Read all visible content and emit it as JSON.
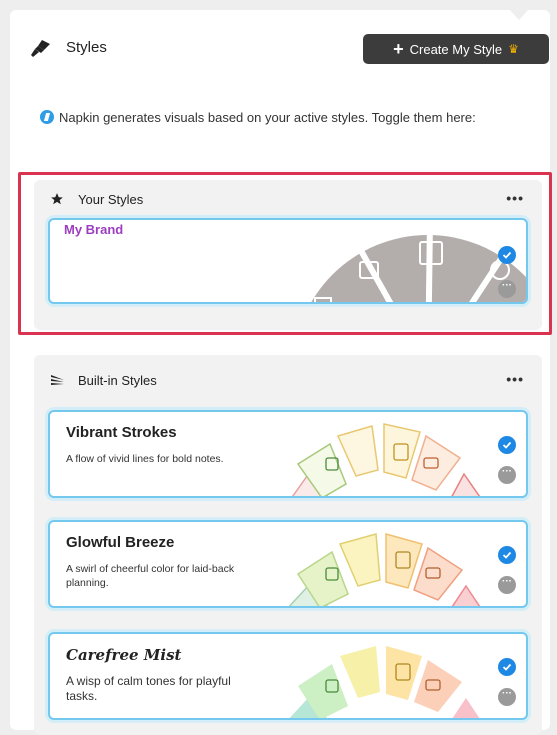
{
  "header": {
    "title": "Styles",
    "create_button_label": "Create My Style",
    "create_button_icon": "plus-icon",
    "premium_icon": "crown-icon"
  },
  "info": {
    "text": "Napkin generates visuals based on your active styles. Toggle them here:"
  },
  "your_styles": {
    "title": "Your Styles",
    "more": "•••",
    "cards": [
      {
        "title": "My Brand",
        "checked": true
      }
    ]
  },
  "builtin_styles": {
    "title": "Built-in Styles",
    "more": "•••",
    "cards": [
      {
        "title": "Vibrant Strokes",
        "description": "A flow of vivid lines for bold notes.",
        "checked": true
      },
      {
        "title": "Glowful Breeze",
        "description": "A swirl of cheerful color for laid-back planning.",
        "checked": true
      },
      {
        "title": "Carefree Mist",
        "description": "A wisp of calm tones for playful tasks.",
        "checked": true
      }
    ]
  },
  "colors": {
    "accent_blue": "#1e88e5",
    "card_border": "#74c8ee",
    "highlight_red": "#d9334f",
    "brand_purple": "#9c3ec0"
  }
}
